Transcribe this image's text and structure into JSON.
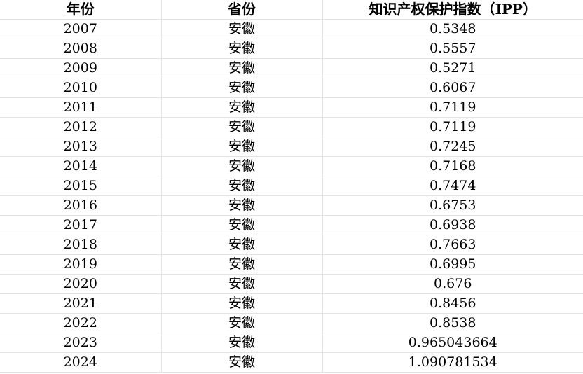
{
  "table": {
    "headers": [
      "年份",
      "省份",
      "知识产权保护指数（IPP）"
    ],
    "rows": [
      [
        "2007",
        "安徽",
        "0.5348"
      ],
      [
        "2008",
        "安徽",
        "0.5557"
      ],
      [
        "2009",
        "安徽",
        "0.5271"
      ],
      [
        "2010",
        "安徽",
        "0.6067"
      ],
      [
        "2011",
        "安徽",
        "0.7119"
      ],
      [
        "2012",
        "安徽",
        "0.7119"
      ],
      [
        "2013",
        "安徽",
        "0.7245"
      ],
      [
        "2014",
        "安徽",
        "0.7168"
      ],
      [
        "2015",
        "安徽",
        "0.7474"
      ],
      [
        "2016",
        "安徽",
        "0.6753"
      ],
      [
        "2017",
        "安徽",
        "0.6938"
      ],
      [
        "2018",
        "安徽",
        "0.7663"
      ],
      [
        "2019",
        "安徽",
        "0.6995"
      ],
      [
        "2020",
        "安徽",
        "0.676"
      ],
      [
        "2021",
        "安徽",
        "0.8456"
      ],
      [
        "2022",
        "安徽",
        "0.8538"
      ],
      [
        "2023",
        "安徽",
        "0.965043664"
      ],
      [
        "2024",
        "安徽",
        "1.090781534"
      ]
    ]
  }
}
